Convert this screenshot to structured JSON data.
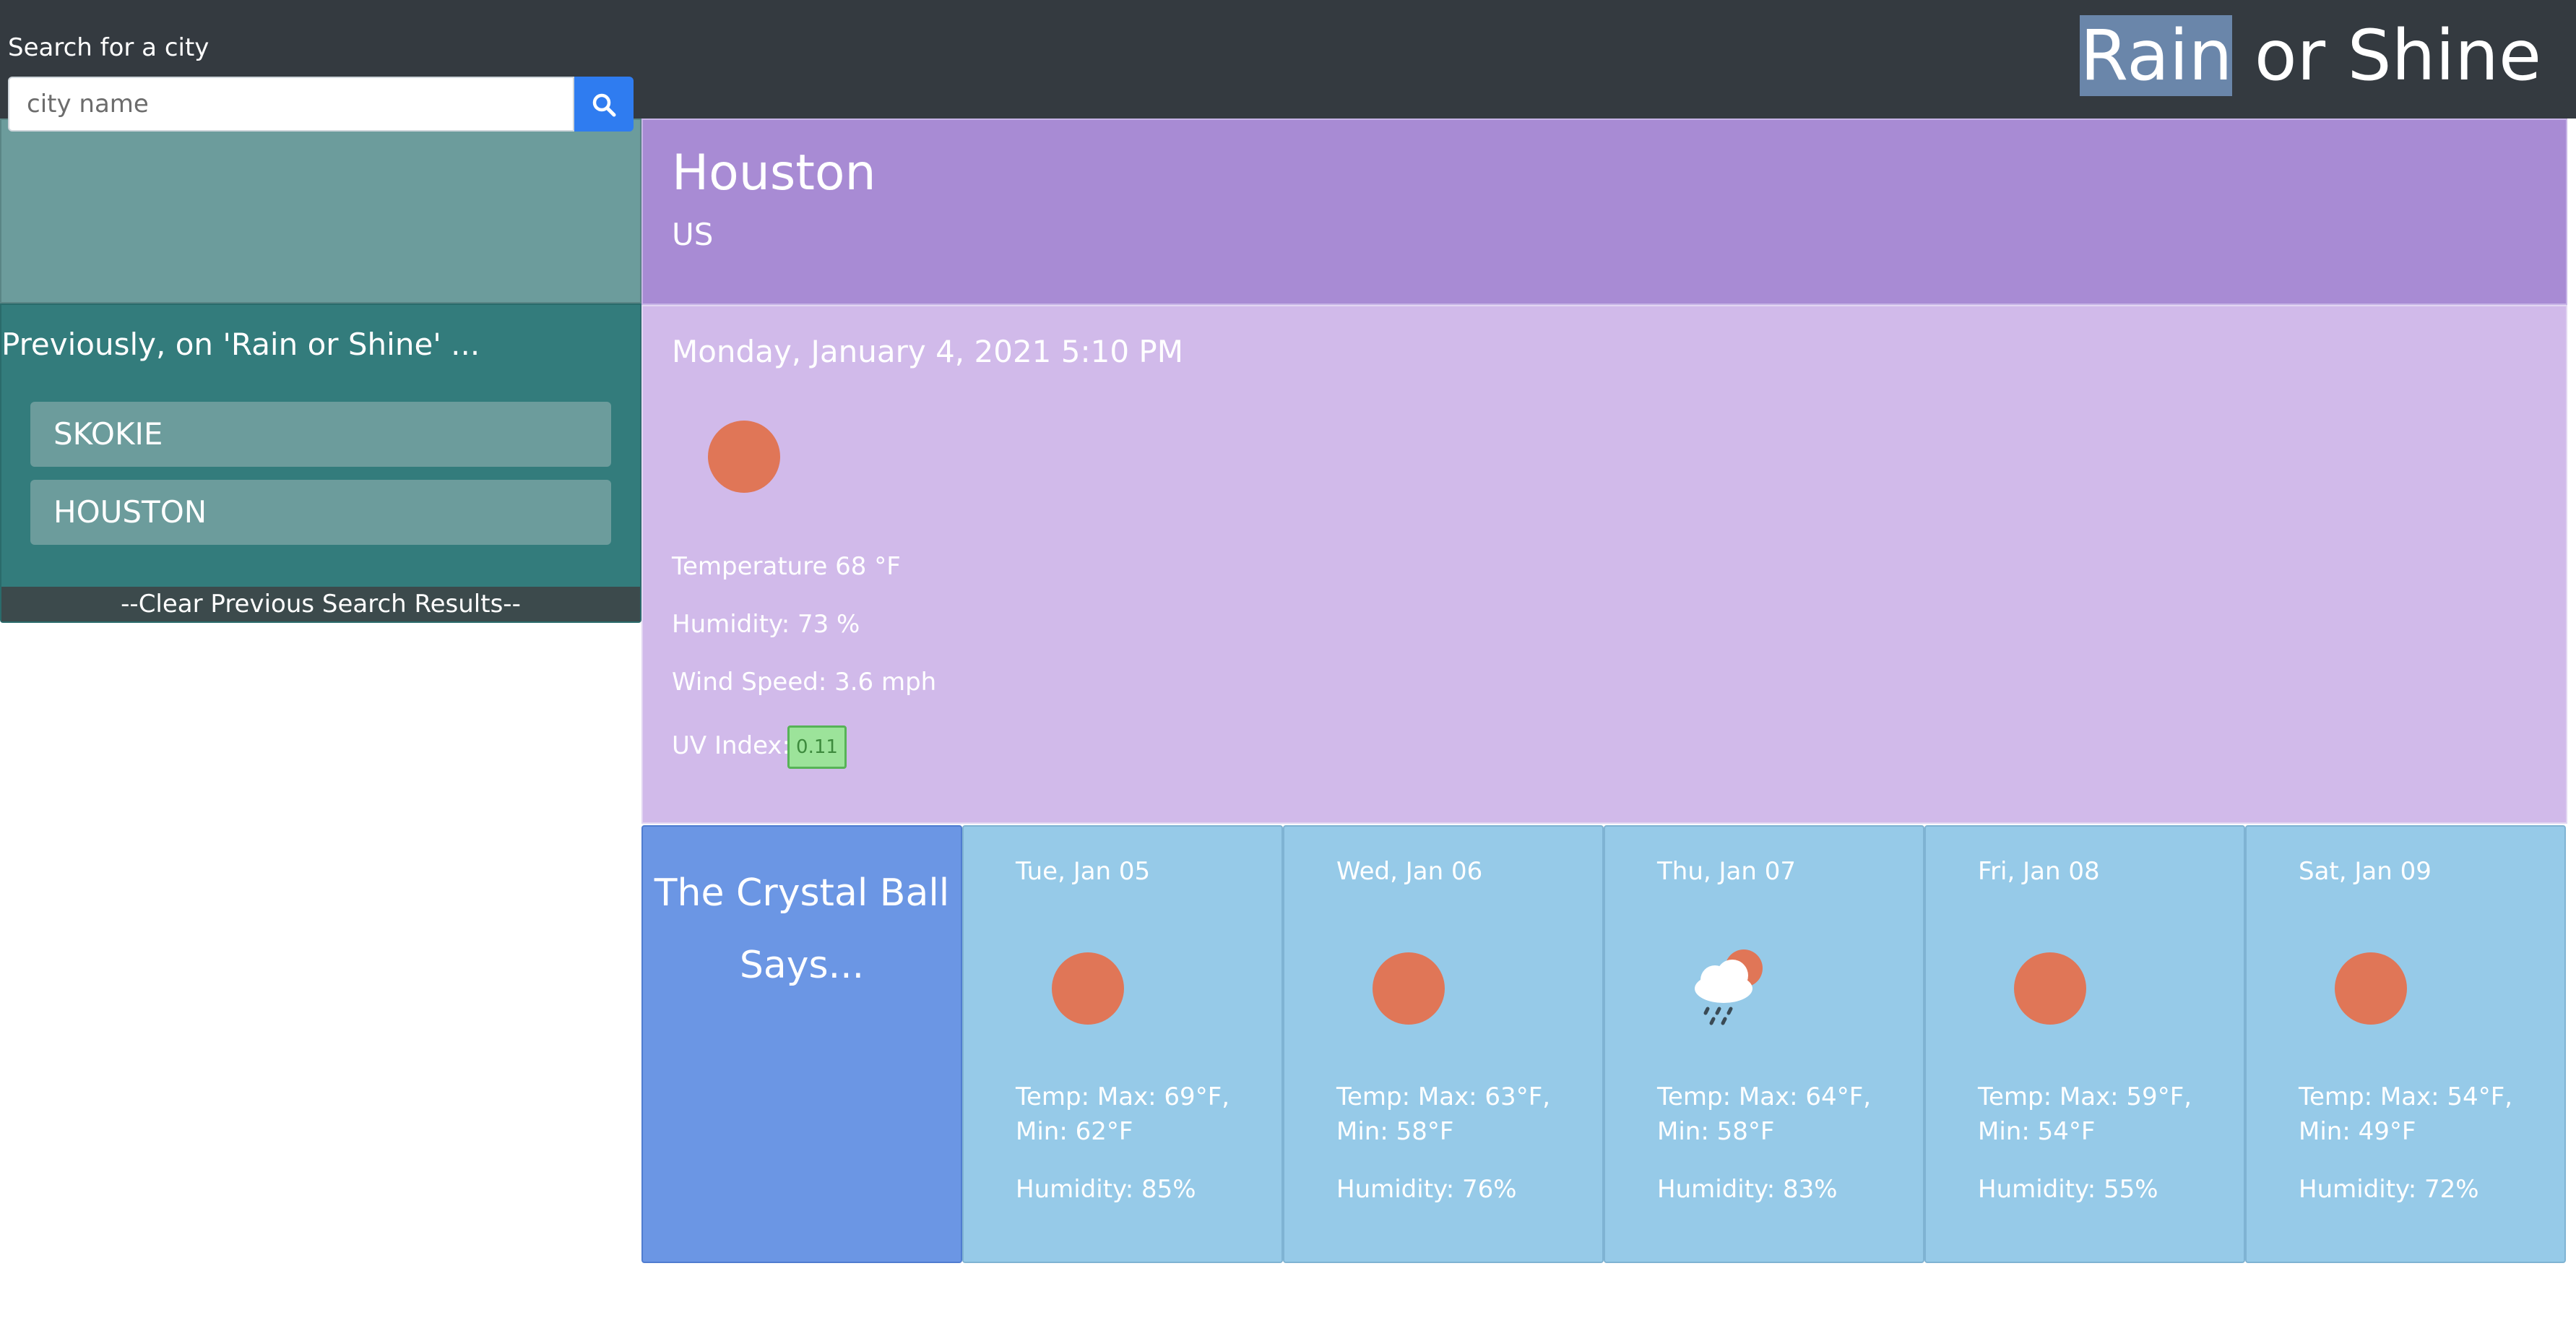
{
  "header": {
    "title_highlighted": "Rain",
    "title_rest": " or Shine"
  },
  "search": {
    "label": "Search for a city",
    "placeholder": "city name"
  },
  "history": {
    "heading": "Previously, on 'Rain or Shine' ...",
    "items": [
      {
        "label": "SKOKIE"
      },
      {
        "label": "HOUSTON"
      }
    ],
    "clear_label": "--Clear Previous Search Results--"
  },
  "city": {
    "name": "Houston",
    "country": "US"
  },
  "current": {
    "datetime": "Monday, January 4, 2021 5:10 PM",
    "icon": "sun-icon",
    "temperature": "Temperature 68 °F",
    "humidity": "Humidity: 73 %",
    "wind": "Wind Speed: 3.6 mph",
    "uv_label": "UV Index:",
    "uv_value": "0.11",
    "uv_color": "#9ce39a"
  },
  "crystal_ball": {
    "text": "The Crystal Ball Says..."
  },
  "forecast": [
    {
      "date": "Tue, Jan 05",
      "icon": "sun-icon",
      "temp": "Temp: Max: 69°F, Min: 62°F",
      "humidity": "Humidity: 85%"
    },
    {
      "date": "Wed, Jan 06",
      "icon": "sun-icon",
      "temp": "Temp: Max: 63°F, Min: 58°F",
      "humidity": "Humidity: 76%"
    },
    {
      "date": "Thu, Jan 07",
      "icon": "rain-cloud-sun-icon",
      "temp": "Temp: Max: 64°F, Min: 58°F",
      "humidity": "Humidity: 83%"
    },
    {
      "date": "Fri, Jan 08",
      "icon": "sun-icon",
      "temp": "Temp: Max: 59°F, Min: 54°F",
      "humidity": "Humidity: 55%"
    },
    {
      "date": "Sat, Jan 09",
      "icon": "sun-icon",
      "temp": "Temp: Max: 54°F, Min: 49°F",
      "humidity": "Humidity: 72%"
    }
  ],
  "colors": {
    "header_bg": "#343a40",
    "search_bg": "#6c9c9c",
    "history_bg": "#337c7c",
    "city_bg": "#a88bd4",
    "current_bg": "#d1baea",
    "crystal_bg": "#6b96e4",
    "forecast_bg": "#96cae8",
    "sun": "#e07657",
    "search_button": "#2f7cf0"
  }
}
